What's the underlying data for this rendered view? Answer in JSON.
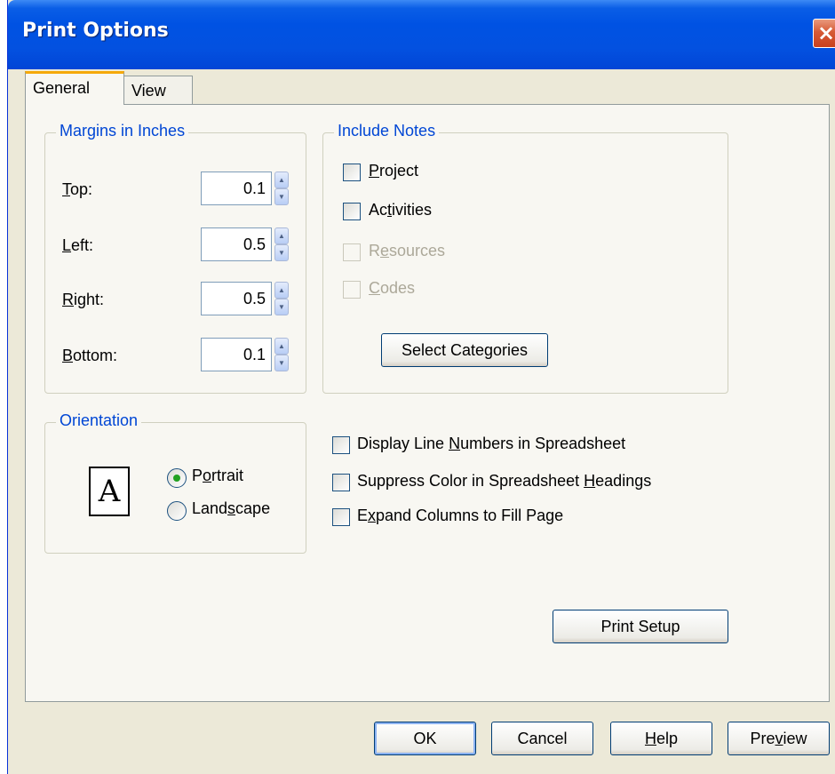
{
  "window": {
    "title": "Print Options"
  },
  "tabs": [
    {
      "label": "General",
      "active": true
    },
    {
      "label": "View",
      "active": false
    }
  ],
  "margins": {
    "title": "Margins in Inches",
    "fields": [
      {
        "label": "Top:",
        "value": "0.1"
      },
      {
        "label": "Left:",
        "value": "0.5"
      },
      {
        "label": "Right:",
        "value": "0.5"
      },
      {
        "label": "Bottom:",
        "value": "0.1"
      }
    ]
  },
  "include_notes": {
    "title": "Include Notes",
    "options": [
      {
        "label": "Project",
        "checked": false,
        "enabled": true
      },
      {
        "label": "Activities",
        "checked": false,
        "enabled": true
      },
      {
        "label": "Resources",
        "checked": false,
        "enabled": false
      },
      {
        "label": "Codes",
        "checked": false,
        "enabled": false
      }
    ],
    "select_button": "Select Categories"
  },
  "orientation": {
    "title": "Orientation",
    "icon_glyph": "A",
    "options": [
      {
        "label": "Portrait",
        "selected": true
      },
      {
        "label": "Landscape",
        "selected": false
      }
    ]
  },
  "spreadsheet_options": [
    {
      "label": "Display Line Numbers in Spreadsheet",
      "checked": false
    },
    {
      "label": "Suppress Color in Spreadsheet Headings",
      "checked": false
    },
    {
      "label": "Expand Columns to Fill Page",
      "checked": false
    }
  ],
  "print_setup_button": "Print Setup",
  "footer": {
    "ok": "OK",
    "cancel": "Cancel",
    "help": "Help",
    "preview": "Preview"
  },
  "colors": {
    "titlebar": "#0052e3",
    "group_title": "#0046d5",
    "tab_highlight": "#f5a90a",
    "radio_dot": "#21a121"
  },
  "icons": {
    "close": "close-icon",
    "spin": "spin-arrows-icon",
    "page": "portrait-page-icon"
  }
}
